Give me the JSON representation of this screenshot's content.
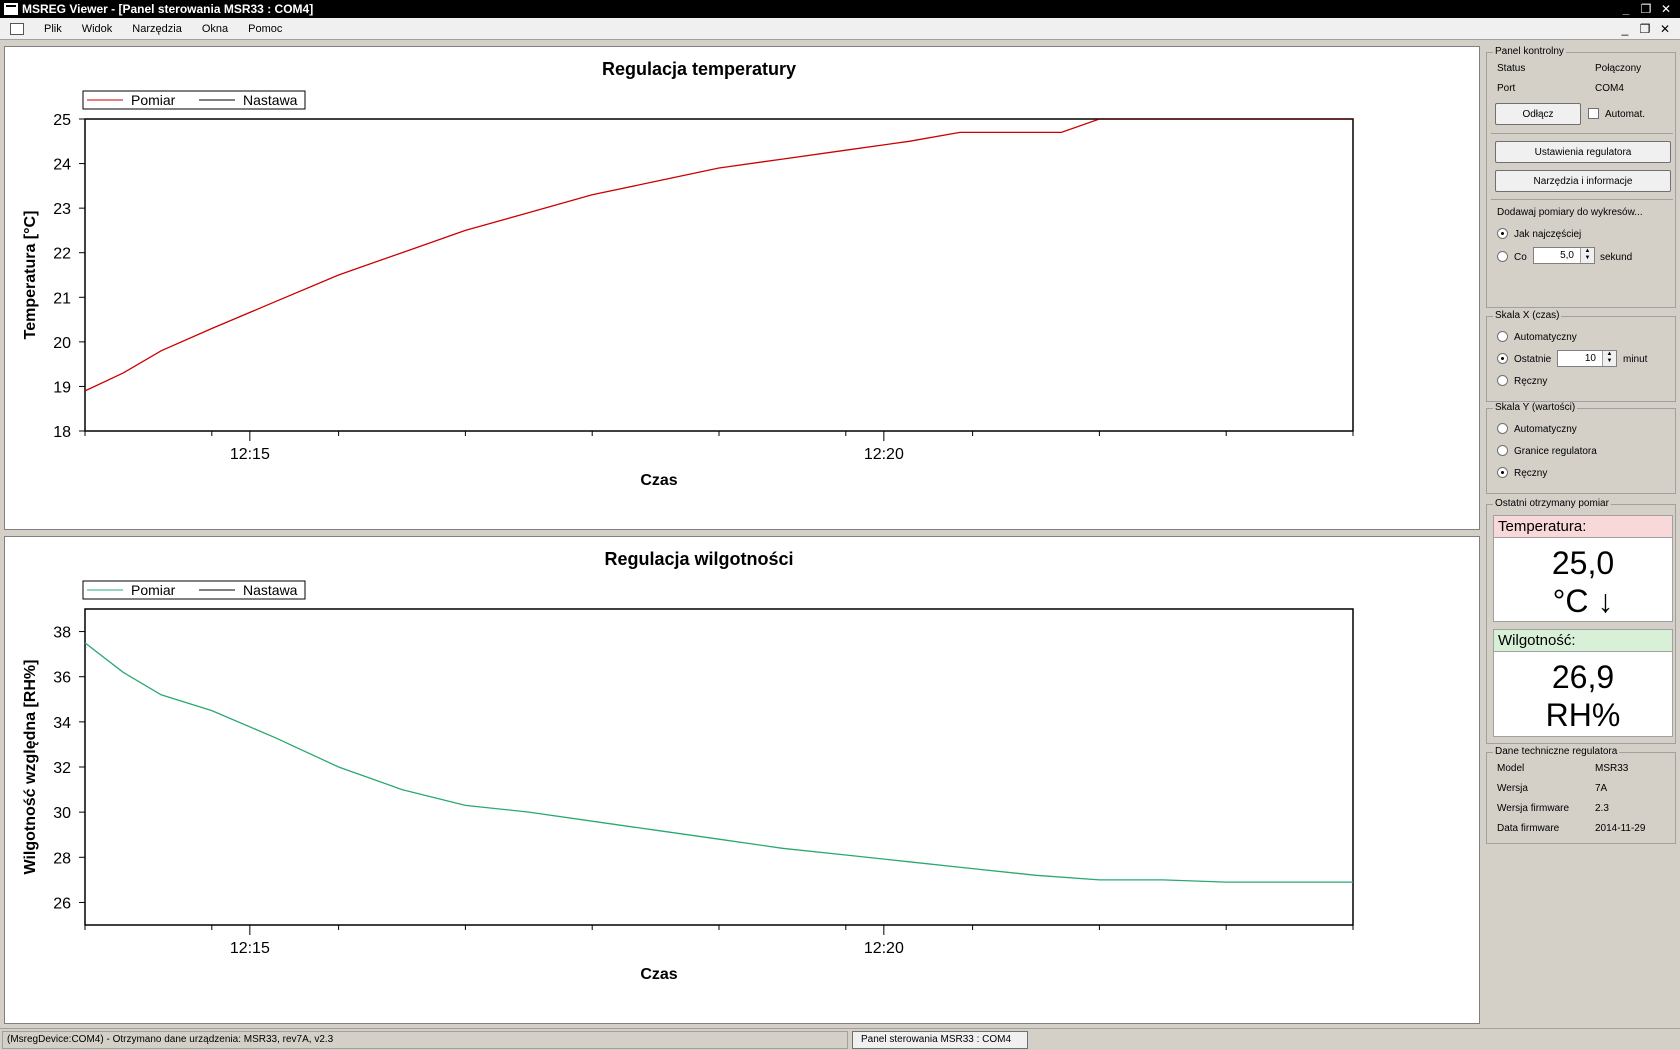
{
  "window": {
    "title": "MSREG Viewer - [Panel sterowania MSR33 : COM4]"
  },
  "menu": [
    "Plik",
    "Widok",
    "Narzędzia",
    "Okna",
    "Pomoc"
  ],
  "charts": {
    "temperature": {
      "chart_data": {
        "type": "line",
        "title": "Regulacja temperatury",
        "xlabel": "Czas",
        "ylabel": "Temperatura [°C]",
        "ylim": [
          18,
          25
        ],
        "yticks": [
          18,
          19,
          20,
          21,
          22,
          23,
          24,
          25
        ],
        "xticks": [
          "12:15",
          "12:20"
        ],
        "xlim_minutes": [
          0,
          10
        ],
        "legend": "top-left",
        "series": [
          {
            "name": "Pomiar",
            "color": "#cc0000",
            "x_minutes": [
              0,
              0.3,
              0.6,
              1,
              1.5,
              2,
              2.5,
              3,
              3.5,
              4,
              4.5,
              5,
              5.5,
              6,
              6.5,
              6.9,
              7.3,
              7.7,
              8,
              8.5,
              9,
              9.5,
              10
            ],
            "values": [
              18.9,
              19.3,
              19.8,
              20.3,
              20.9,
              21.5,
              22.0,
              22.5,
              22.9,
              23.3,
              23.6,
              23.9,
              24.1,
              24.3,
              24.5,
              24.7,
              24.7,
              24.7,
              25.0,
              25.0,
              25.0,
              25.0,
              25.0
            ]
          },
          {
            "name": "Nastawa",
            "color": "#000000",
            "x_minutes": [
              0,
              10
            ],
            "values": [
              25.0,
              25.0
            ]
          }
        ]
      }
    },
    "humidity": {
      "chart_data": {
        "type": "line",
        "title": "Regulacja wilgotności",
        "xlabel": "Czas",
        "ylabel": "Wilgotność względna [RH%]",
        "ylim": [
          25,
          39
        ],
        "yticks": [
          26,
          28,
          30,
          32,
          34,
          36,
          38
        ],
        "xticks": [
          "12:15",
          "12:20"
        ],
        "xlim_minutes": [
          0,
          10
        ],
        "legend": "top-left",
        "series": [
          {
            "name": "Pomiar",
            "color": "#2aa870",
            "x_minutes": [
              0,
              0.3,
              0.6,
              1,
              1.5,
              2,
              2.5,
              3,
              3.5,
              4,
              4.5,
              5,
              5.5,
              6,
              6.5,
              7,
              7.5,
              8,
              8.5,
              9,
              9.5,
              10
            ],
            "values": [
              37.5,
              36.2,
              35.2,
              34.5,
              33.3,
              32.0,
              31.0,
              30.3,
              30.0,
              29.6,
              29.2,
              28.8,
              28.4,
              28.1,
              27.8,
              27.5,
              27.2,
              27.0,
              27.0,
              26.9,
              26.9,
              26.9
            ]
          },
          {
            "name": "Nastawa",
            "color": "#000000",
            "x_minutes": [],
            "values": []
          }
        ]
      }
    }
  },
  "panel": {
    "title": "Panel kontrolny",
    "status_label": "Status",
    "status_value": "Połączony",
    "port_label": "Port",
    "port_value": "COM4",
    "disconnect_button": "Odłącz",
    "auto_checkbox": "Automat.",
    "regulator_settings_button": "Ustawienia regulatora",
    "tools_button": "Narzędzia i informacje",
    "add_measurements_label": "Dodawaj pomiary do wykresów...",
    "option_fastest": "Jak najczęściej",
    "option_every": "Co",
    "every_value": "5,0",
    "every_unit": "sekund"
  },
  "scale_x": {
    "title": "Skala X (czas)",
    "auto": "Automatyczny",
    "last": "Ostatnie",
    "last_value": "10",
    "last_unit": "minut",
    "manual": "Ręczny"
  },
  "scale_y": {
    "title": "Skala Y (wartości)",
    "auto": "Automatyczny",
    "limits": "Granice regulatora",
    "manual": "Ręczny"
  },
  "last_measurement": {
    "title": "Ostatni otrzymany pomiar",
    "temp_label": "Temperatura:",
    "temp_value": "25,0",
    "temp_unit": "°C ↓",
    "hum_label": "Wilgotność:",
    "hum_value": "26,9",
    "hum_unit": "RH%",
    "temp_head_color": "#f8d8d8",
    "hum_head_color": "#d8f0d8"
  },
  "tech": {
    "title": "Dane techniczne regulatora",
    "model_label": "Model",
    "model_value": "MSR33",
    "version_label": "Wersja",
    "version_value": "7A",
    "fw_label": "Wersja firmware",
    "fw_value": "2.3",
    "fwdate_label": "Data firmware",
    "fwdate_value": "2014-11-29"
  },
  "statusbar": {
    "message": "(MsregDevice:COM4) - Otrzymano dane urządzenia: MSR33, rev7A, v2.3",
    "tab": "Panel sterowania MSR33 : COM4"
  }
}
